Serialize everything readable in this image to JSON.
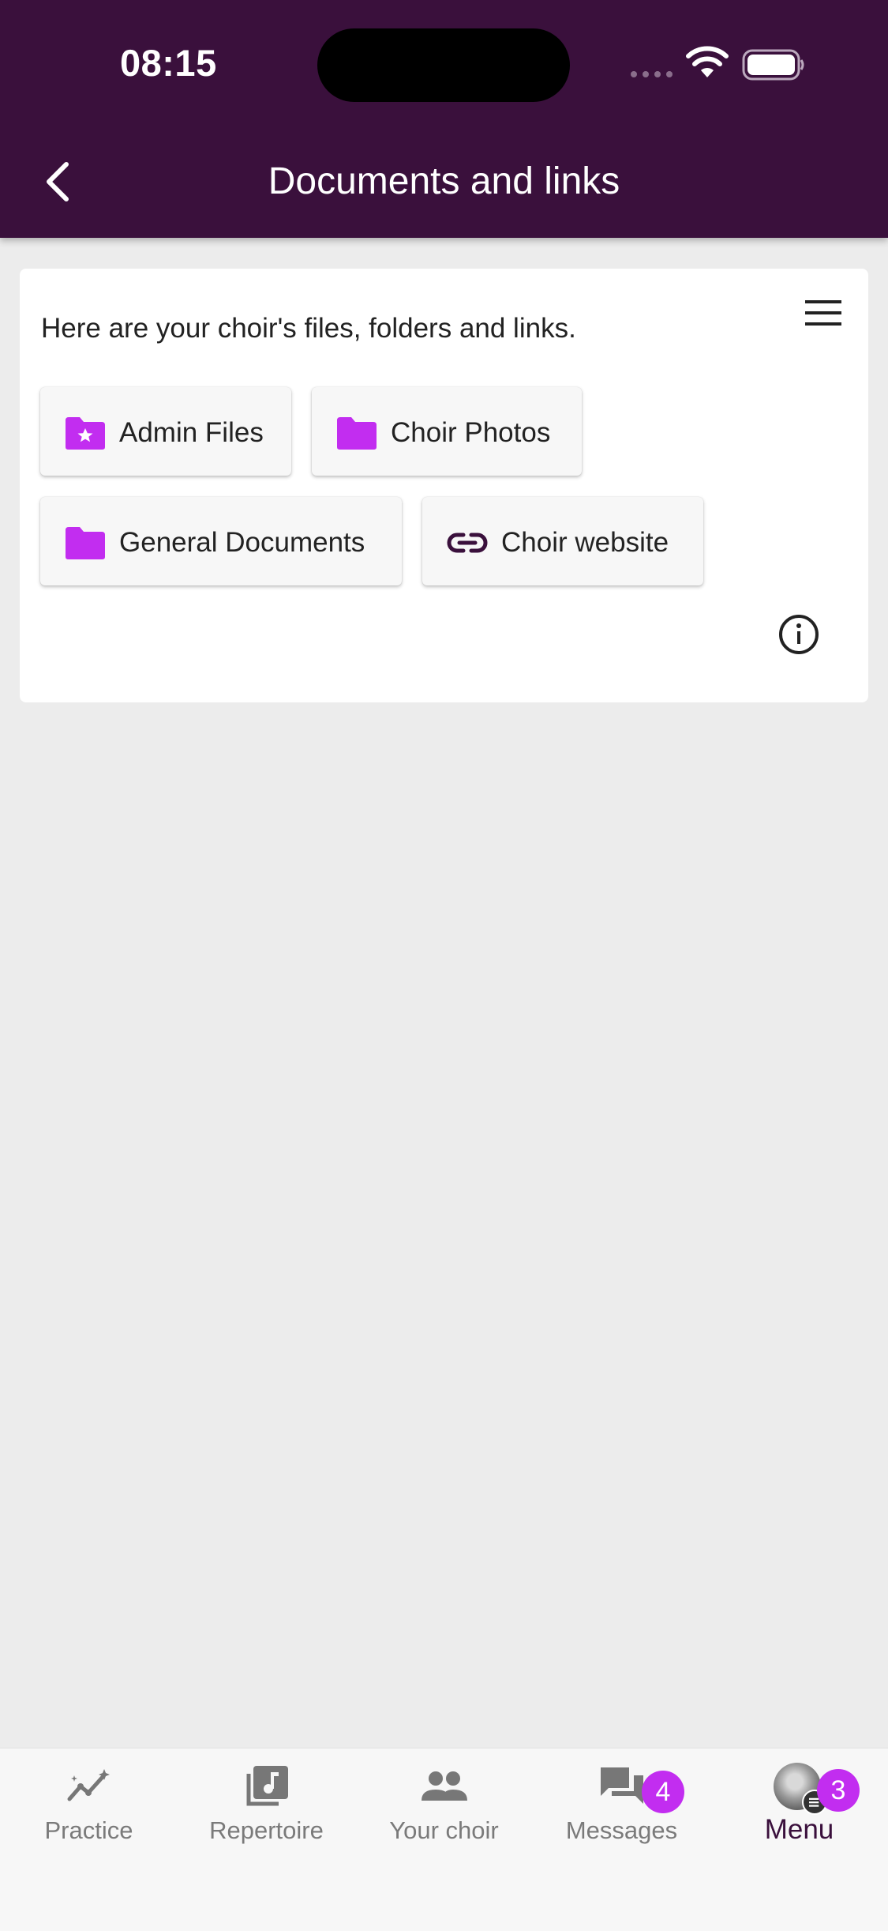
{
  "status_bar": {
    "time": "08:15"
  },
  "header": {
    "title": "Documents and links"
  },
  "card": {
    "intro": "Here are your choir's files, folders and links.",
    "chips": [
      {
        "label": "Admin Files",
        "icon": "folder-star-icon"
      },
      {
        "label": "Choir Photos",
        "icon": "folder-icon"
      },
      {
        "label": "General Documents",
        "icon": "folder-icon"
      },
      {
        "label": "Choir website",
        "icon": "link-icon"
      }
    ]
  },
  "bottom_nav": {
    "items": [
      {
        "label": "Practice",
        "icon": "practice-sparkline-icon"
      },
      {
        "label": "Repertoire",
        "icon": "music-library-icon"
      },
      {
        "label": "Your choir",
        "icon": "people-icon"
      },
      {
        "label": "Messages",
        "icon": "chat-icon",
        "badge": "4"
      },
      {
        "label": "Menu",
        "icon": "avatar",
        "badge": "3",
        "active": true
      }
    ]
  },
  "colors": {
    "header_bg": "#3a103c",
    "accent": "#c22df0",
    "page_bg": "#ececec"
  }
}
